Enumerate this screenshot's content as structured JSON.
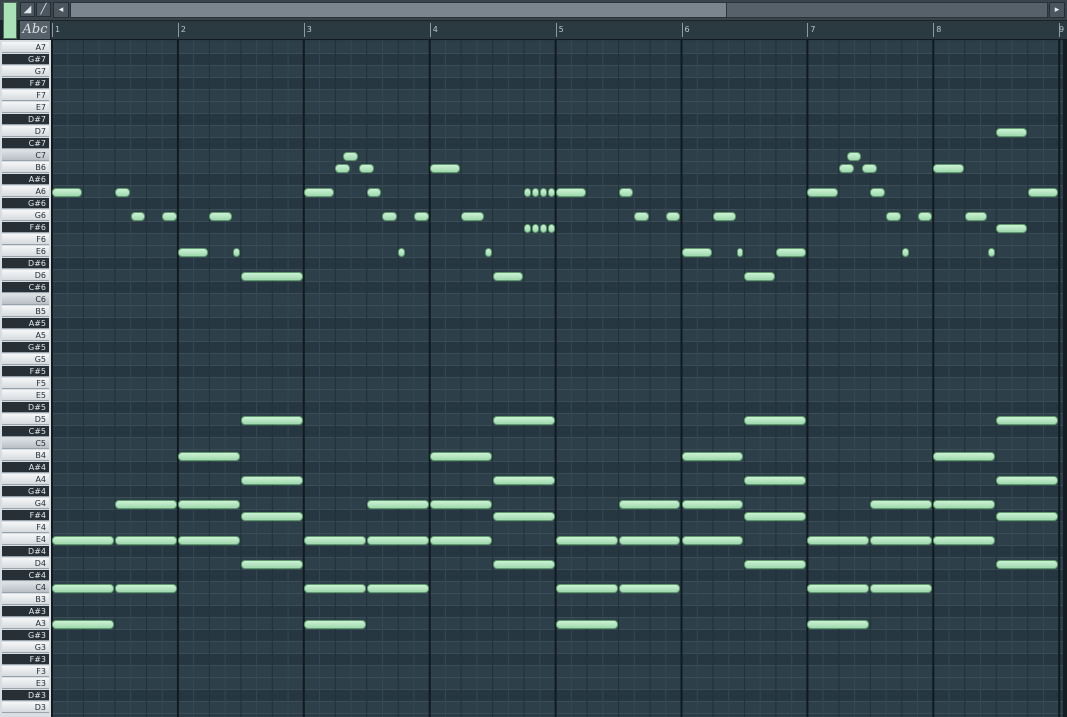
{
  "toolbar": {
    "abc_label": "Abc",
    "icons": [
      "tool-triangle-icon",
      "pencil-icon"
    ],
    "scroll_left_icon": "◂",
    "scroll_right_icon": "▸",
    "scroll_thumb_fraction": 0.67
  },
  "ruler": {
    "bars": [
      "1",
      "2",
      "3",
      "4",
      "5",
      "6",
      "7",
      "8",
      "9"
    ]
  },
  "keyboard": {
    "keys": [
      "A7",
      "G#7",
      "G7",
      "F#7",
      "F7",
      "E7",
      "D#7",
      "D7",
      "C#7",
      "C7",
      "B6",
      "A#6",
      "A6",
      "G#6",
      "G6",
      "F#6",
      "F6",
      "E6",
      "D#6",
      "D6",
      "C#6",
      "C6",
      "B5",
      "A#5",
      "A5",
      "G#5",
      "G5",
      "F#5",
      "F5",
      "E5",
      "D#5",
      "D5",
      "C#5",
      "C5",
      "B4",
      "A#4",
      "A4",
      "G#4",
      "G4",
      "F#4",
      "F4",
      "E4",
      "D#4",
      "D4",
      "C#4",
      "C4",
      "B3",
      "A#3",
      "A3",
      "G#3",
      "G3",
      "F#3",
      "F3",
      "E3",
      "D#3",
      "D3"
    ]
  },
  "colors": {
    "note_fill": "#b8e8c4",
    "note_border": "#5e9a6c",
    "grid_bg": "#2b3c46",
    "bar_line": "#101a20"
  },
  "notes": [
    {
      "pitch": "A6",
      "start": 1,
      "len": 0.25
    },
    {
      "pitch": "A6",
      "start": 1.5,
      "len": 0.125
    },
    {
      "pitch": "G6",
      "start": 1.625,
      "len": 0.125
    },
    {
      "pitch": "G6",
      "start": 1.875,
      "len": 0.125
    },
    {
      "pitch": "E6",
      "start": 2,
      "len": 0.25
    },
    {
      "pitch": "G6",
      "start": 2.25,
      "len": 0.1875
    },
    {
      "pitch": "E6",
      "start": 2.4375,
      "len": 0.0625
    },
    {
      "pitch": "D6",
      "start": 2.5,
      "len": 0.5
    },
    {
      "pitch": "A6",
      "start": 3,
      "len": 0.25
    },
    {
      "pitch": "B6",
      "start": 3.25,
      "len": 0.125
    },
    {
      "pitch": "C7",
      "start": 3.3125,
      "len": 0.125
    },
    {
      "pitch": "B6",
      "start": 3.4375,
      "len": 0.125
    },
    {
      "pitch": "A6",
      "start": 3.5,
      "len": 0.125
    },
    {
      "pitch": "G6",
      "start": 3.625,
      "len": 0.125
    },
    {
      "pitch": "E6",
      "start": 3.75,
      "len": 0.0625
    },
    {
      "pitch": "G6",
      "start": 3.875,
      "len": 0.125
    },
    {
      "pitch": "B6",
      "start": 4,
      "len": 0.25
    },
    {
      "pitch": "G6",
      "start": 4.25,
      "len": 0.1875
    },
    {
      "pitch": "E6",
      "start": 4.4375,
      "len": 0.0625
    },
    {
      "pitch": "D6",
      "start": 4.5,
      "len": 0.25
    },
    {
      "pitch": "A6",
      "start": 4.75,
      "len": 0.0625
    },
    {
      "pitch": "A6",
      "start": 4.8125,
      "len": 0.0625
    },
    {
      "pitch": "A6",
      "start": 4.875,
      "len": 0.0625
    },
    {
      "pitch": "A6",
      "start": 4.9375,
      "len": 0.0625
    },
    {
      "pitch": "F#6",
      "start": 4.75,
      "len": 0.0625
    },
    {
      "pitch": "F#6",
      "start": 4.8125,
      "len": 0.0625
    },
    {
      "pitch": "F#6",
      "start": 4.875,
      "len": 0.0625
    },
    {
      "pitch": "F#6",
      "start": 4.9375,
      "len": 0.0625
    },
    {
      "pitch": "A6",
      "start": 5,
      "len": 0.25
    },
    {
      "pitch": "A6",
      "start": 5.5,
      "len": 0.125
    },
    {
      "pitch": "G6",
      "start": 5.625,
      "len": 0.125
    },
    {
      "pitch": "G6",
      "start": 5.875,
      "len": 0.125
    },
    {
      "pitch": "E6",
      "start": 6,
      "len": 0.25
    },
    {
      "pitch": "G6",
      "start": 6.25,
      "len": 0.1875
    },
    {
      "pitch": "E6",
      "start": 6.4375,
      "len": 0.0625
    },
    {
      "pitch": "D6",
      "start": 6.5,
      "len": 0.25
    },
    {
      "pitch": "E6",
      "start": 6.75,
      "len": 0.25
    },
    {
      "pitch": "A6",
      "start": 7,
      "len": 0.25
    },
    {
      "pitch": "B6",
      "start": 7.25,
      "len": 0.125
    },
    {
      "pitch": "C7",
      "start": 7.3125,
      "len": 0.125
    },
    {
      "pitch": "B6",
      "start": 7.4375,
      "len": 0.125
    },
    {
      "pitch": "A6",
      "start": 7.5,
      "len": 0.125
    },
    {
      "pitch": "G6",
      "start": 7.625,
      "len": 0.125
    },
    {
      "pitch": "E6",
      "start": 7.75,
      "len": 0.0625
    },
    {
      "pitch": "G6",
      "start": 7.875,
      "len": 0.125
    },
    {
      "pitch": "B6",
      "start": 8,
      "len": 0.25
    },
    {
      "pitch": "G6",
      "start": 8.25,
      "len": 0.1875
    },
    {
      "pitch": "E6",
      "start": 8.4375,
      "len": 0.0625
    },
    {
      "pitch": "D7",
      "start": 8.5,
      "len": 0.25
    },
    {
      "pitch": "F#6",
      "start": 8.5,
      "len": 0.25
    },
    {
      "pitch": "A6",
      "start": 8.75,
      "len": 0.25
    },
    {
      "pitch": "E4",
      "start": 1,
      "len": 0.5
    },
    {
      "pitch": "C4",
      "start": 1,
      "len": 0.5
    },
    {
      "pitch": "A3",
      "start": 1,
      "len": 0.5
    },
    {
      "pitch": "G4",
      "start": 1.5,
      "len": 0.5
    },
    {
      "pitch": "E4",
      "start": 1.5,
      "len": 0.5
    },
    {
      "pitch": "C4",
      "start": 1.5,
      "len": 0.5
    },
    {
      "pitch": "B4",
      "start": 2,
      "len": 0.5
    },
    {
      "pitch": "G4",
      "start": 2,
      "len": 0.5
    },
    {
      "pitch": "E4",
      "start": 2,
      "len": 0.5
    },
    {
      "pitch": "D5",
      "start": 2.5,
      "len": 0.5
    },
    {
      "pitch": "A4",
      "start": 2.5,
      "len": 0.5
    },
    {
      "pitch": "F#4",
      "start": 2.5,
      "len": 0.5
    },
    {
      "pitch": "D4",
      "start": 2.5,
      "len": 0.5
    },
    {
      "pitch": "E4",
      "start": 3,
      "len": 0.5
    },
    {
      "pitch": "C4",
      "start": 3,
      "len": 0.5
    },
    {
      "pitch": "A3",
      "start": 3,
      "len": 0.5
    },
    {
      "pitch": "G4",
      "start": 3.5,
      "len": 0.5
    },
    {
      "pitch": "E4",
      "start": 3.5,
      "len": 0.5
    },
    {
      "pitch": "C4",
      "start": 3.5,
      "len": 0.5
    },
    {
      "pitch": "B4",
      "start": 4,
      "len": 0.5
    },
    {
      "pitch": "G4",
      "start": 4,
      "len": 0.5
    },
    {
      "pitch": "E4",
      "start": 4,
      "len": 0.5
    },
    {
      "pitch": "D5",
      "start": 4.5,
      "len": 0.5
    },
    {
      "pitch": "A4",
      "start": 4.5,
      "len": 0.5
    },
    {
      "pitch": "F#4",
      "start": 4.5,
      "len": 0.5
    },
    {
      "pitch": "D4",
      "start": 4.5,
      "len": 0.5
    },
    {
      "pitch": "E4",
      "start": 5,
      "len": 0.5
    },
    {
      "pitch": "C4",
      "start": 5,
      "len": 0.5
    },
    {
      "pitch": "A3",
      "start": 5,
      "len": 0.5
    },
    {
      "pitch": "G4",
      "start": 5.5,
      "len": 0.5
    },
    {
      "pitch": "E4",
      "start": 5.5,
      "len": 0.5
    },
    {
      "pitch": "C4",
      "start": 5.5,
      "len": 0.5
    },
    {
      "pitch": "B4",
      "start": 6,
      "len": 0.5
    },
    {
      "pitch": "G4",
      "start": 6,
      "len": 0.5
    },
    {
      "pitch": "E4",
      "start": 6,
      "len": 0.5
    },
    {
      "pitch": "D5",
      "start": 6.5,
      "len": 0.5
    },
    {
      "pitch": "A4",
      "start": 6.5,
      "len": 0.5
    },
    {
      "pitch": "F#4",
      "start": 6.5,
      "len": 0.5
    },
    {
      "pitch": "D4",
      "start": 6.5,
      "len": 0.5
    },
    {
      "pitch": "E4",
      "start": 7,
      "len": 0.5
    },
    {
      "pitch": "C4",
      "start": 7,
      "len": 0.5
    },
    {
      "pitch": "A3",
      "start": 7,
      "len": 0.5
    },
    {
      "pitch": "G4",
      "start": 7.5,
      "len": 0.5
    },
    {
      "pitch": "E4",
      "start": 7.5,
      "len": 0.5
    },
    {
      "pitch": "C4",
      "start": 7.5,
      "len": 0.5
    },
    {
      "pitch": "B4",
      "start": 8,
      "len": 0.5
    },
    {
      "pitch": "G4",
      "start": 8,
      "len": 0.5
    },
    {
      "pitch": "E4",
      "start": 8,
      "len": 0.5
    },
    {
      "pitch": "D5",
      "start": 8.5,
      "len": 0.5
    },
    {
      "pitch": "A4",
      "start": 8.5,
      "len": 0.5
    },
    {
      "pitch": "F#4",
      "start": 8.5,
      "len": 0.5
    },
    {
      "pitch": "D4",
      "start": 8.5,
      "len": 0.5
    }
  ]
}
